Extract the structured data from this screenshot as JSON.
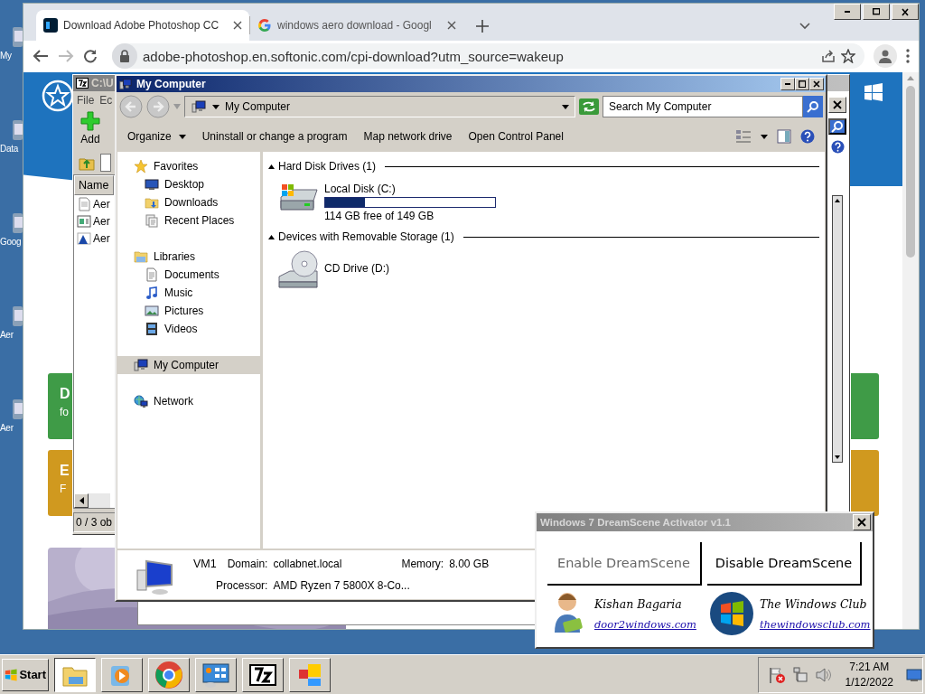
{
  "desktop_icons": [
    {
      "label": "My"
    },
    {
      "label": "Data"
    },
    {
      "label": "Goog"
    },
    {
      "label": "Aer"
    },
    {
      "label": "Aer"
    }
  ],
  "browser": {
    "tabs": [
      {
        "title": "Download Adobe Photoshop CC",
        "kind": "photoshop",
        "selected": true
      },
      {
        "title": "windows aero download - Googl",
        "kind": "google",
        "selected": false
      }
    ],
    "address": "adobe-photoshop.en.softonic.com/cpi-download?utm_source=wakeup",
    "page": {
      "cards": [
        {
          "title": "D",
          "subtitle": "fo",
          "color": "#3f9b47"
        },
        {
          "title": "E",
          "subtitle": "F",
          "color": "#d0991f"
        }
      ]
    }
  },
  "archive_window": {
    "title": "C:\\U",
    "menu": [
      "File",
      "Ec"
    ],
    "toolbar": [
      {
        "label": "Add"
      }
    ],
    "columns": [
      "Name"
    ],
    "rows": [
      {
        "kind": "text",
        "name": "Aer"
      },
      {
        "kind": "app",
        "name": "Aer"
      },
      {
        "name": "Aer"
      }
    ],
    "status": "0 / 3 ob"
  },
  "explorer": {
    "title": "My Computer",
    "address": "My Computer",
    "search": {
      "placeholder": "Search My Computer"
    },
    "commands": [
      {
        "label": "Organize",
        "menu": true
      },
      {
        "label": "Uninstall or change a program",
        "menu": false
      },
      {
        "label": "Map network drive",
        "menu": false
      },
      {
        "label": "Open Control Panel",
        "menu": false
      }
    ],
    "nav": [
      {
        "kind": "favorites",
        "label": "Favorites",
        "selected": false,
        "children": [
          {
            "kind": "desktop",
            "label": "Desktop",
            "selected": false
          },
          {
            "kind": "downloads",
            "label": "Downloads",
            "selected": false
          },
          {
            "kind": "recent",
            "label": "Recent Places",
            "selected": false
          }
        ]
      },
      {
        "kind": "libraries",
        "label": "Libraries",
        "selected": false,
        "children": [
          {
            "kind": "documents",
            "label": "Documents",
            "selected": false
          },
          {
            "kind": "music",
            "label": "Music",
            "selected": false
          },
          {
            "kind": "pictures",
            "label": "Pictures",
            "selected": false
          },
          {
            "kind": "videos",
            "label": "Videos",
            "selected": false
          }
        ]
      },
      {
        "kind": "computer",
        "label": "My Computer",
        "selected": true
      },
      {
        "kind": "network",
        "label": "Network",
        "selected": false
      }
    ],
    "groups": [
      {
        "title": "Hard Disk Drives (1)",
        "expanded": true,
        "items": [
          {
            "kind": "hdd",
            "name": "Local Disk (C:)",
            "level": 0.235,
            "reading": "114 GB free of 149 GB"
          }
        ]
      },
      {
        "title": "Devices with Removable Storage (1)",
        "expanded": true,
        "items": [
          {
            "kind": "cd",
            "name": "CD Drive (D:)"
          }
        ]
      }
    ],
    "details": {
      "name": "VM1",
      "fields": [
        {
          "label": "Domain:",
          "value": "collabnet.local"
        },
        {
          "label": "Memory:",
          "value": "8.00 GB"
        },
        {
          "label": "Processor:",
          "value": "AMD Ryzen 7 5800X 8-Co..."
        }
      ]
    }
  },
  "dreamscene": {
    "title": "Windows 7 DreamScene Activator v1.1",
    "active": false,
    "buttons": [
      {
        "label": "Enable DreamScene",
        "disabled": true
      },
      {
        "label": "Disable DreamScene",
        "disabled": false
      }
    ],
    "credits": [
      {
        "kind": "person",
        "name": "Kishan Bagaria",
        "link": "door2windows.com"
      },
      {
        "kind": "windows",
        "name": "The Windows Club",
        "link": "thewindowsclub.com"
      }
    ]
  },
  "taskbar": {
    "start": "Start",
    "apps": [
      {
        "kind": "explorer",
        "selected": true
      },
      {
        "kind": "media",
        "selected": false
      },
      {
        "kind": "chrome",
        "selected": false
      },
      {
        "kind": "control-panel",
        "selected": false
      },
      {
        "kind": "archiver",
        "selected": false
      },
      {
        "kind": "tiles",
        "selected": false
      }
    ],
    "clock": {
      "time": "7:21 AM",
      "date": "1/12/2022"
    }
  }
}
